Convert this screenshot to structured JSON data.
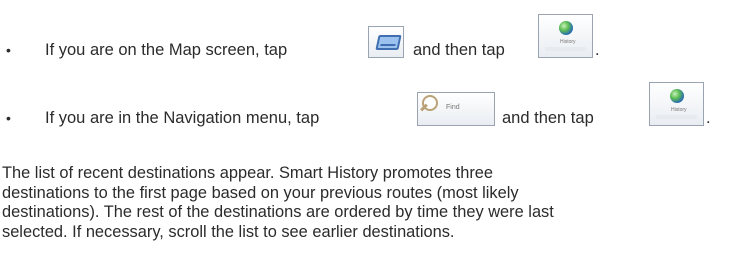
{
  "bullets": [
    {
      "marker": "•",
      "before": "If you are on the Map screen, tap",
      "middle": "and then tap",
      "after": ".",
      "first_button": {
        "icon": "map-icon"
      },
      "second_button": {
        "icon": "history-globe-icon",
        "caption": "History"
      }
    },
    {
      "marker": "•",
      "before": "If you are in the Navigation menu, tap",
      "middle": "and then tap",
      "after": ".",
      "first_button": {
        "icon": "find-magnifier-icon",
        "label": "Find"
      },
      "second_button": {
        "icon": "history-globe-icon",
        "caption": "History"
      }
    }
  ],
  "paragraph": {
    "lines": [
      "The list of recent destinations appear. Smart History promotes three",
      "destinations to the first page based on your previous routes (most likely",
      "destinations). The rest of the destinations are ordered by time they were last",
      "selected. If necessary, scroll the list to see earlier destinations."
    ]
  }
}
